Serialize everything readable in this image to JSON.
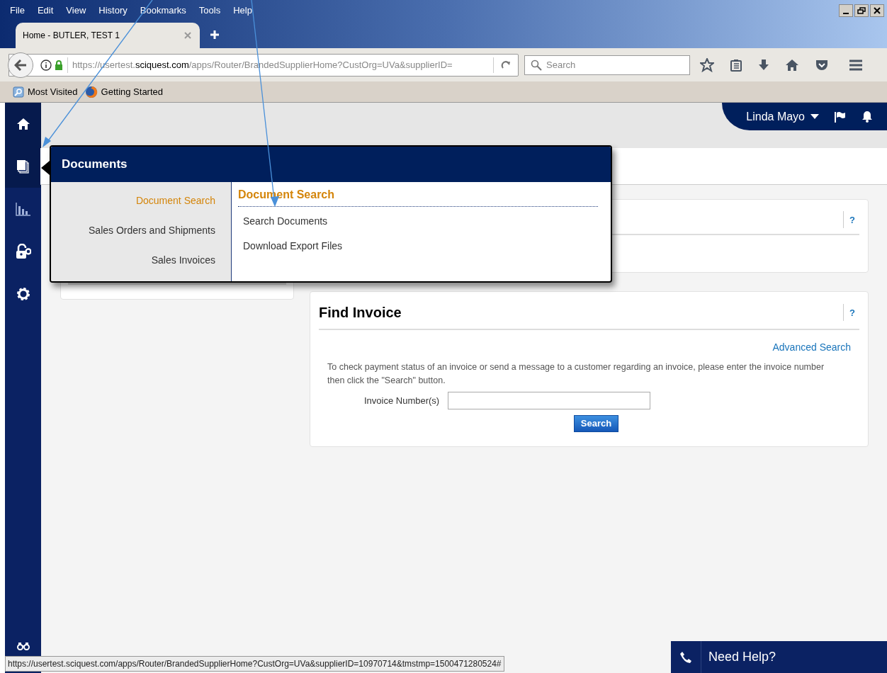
{
  "menu_bar": [
    "File",
    "Edit",
    "View",
    "History",
    "Bookmarks",
    "Tools",
    "Help"
  ],
  "tabs": [
    {
      "label": "Home - BUTLER, TEST 1",
      "selected": true
    }
  ],
  "address_bar": {
    "prefix": "https://usertest.",
    "domain": "sciquest.com",
    "path": "/apps/Router/BrandedSupplierHome?CustOrg=UVa&supplierID="
  },
  "search": {
    "placeholder": "Search"
  },
  "bookmarks": [
    {
      "label": "Most Visited",
      "kind": "folder"
    },
    {
      "label": "Getting Started",
      "kind": "browser"
    }
  ],
  "user_menu": {
    "name": "Linda Mayo"
  },
  "sidebar": {
    "items": [
      {
        "kind": "home",
        "selected": true
      },
      {
        "kind": "documents",
        "selected": true
      },
      {
        "kind": "chart",
        "selected": false
      },
      {
        "kind": "lock",
        "selected": false
      },
      {
        "kind": "gear",
        "selected": false
      }
    ]
  },
  "documents_menu": {
    "title": "Documents",
    "sections": [
      {
        "label": "Document Search",
        "selected": true
      },
      {
        "label": "Sales Orders and Shipments",
        "selected": false
      },
      {
        "label": "Sales Invoices",
        "selected": false
      }
    ],
    "heading": "Document Search",
    "links": [
      "Search Documents",
      "Download Export Files"
    ]
  },
  "top_card": {
    "help": "?"
  },
  "find_invoice": {
    "title": "Find Invoice",
    "help": "?",
    "advanced_link": "Advanced Search",
    "instructions": "To check payment status of an invoice or send a message to a customer regarding an invoice, please enter the invoice number then click the \"Search\" button.",
    "field_label": "Invoice Number(s)",
    "button": "Search"
  },
  "status_url": "https://usertest.sciquest.com/apps/Router/BrandedSupplierHome?CustOrg=UVa&supplierID=10970714&tmstmp=1500471280524#",
  "help_bar": {
    "label": "Need Help?"
  }
}
